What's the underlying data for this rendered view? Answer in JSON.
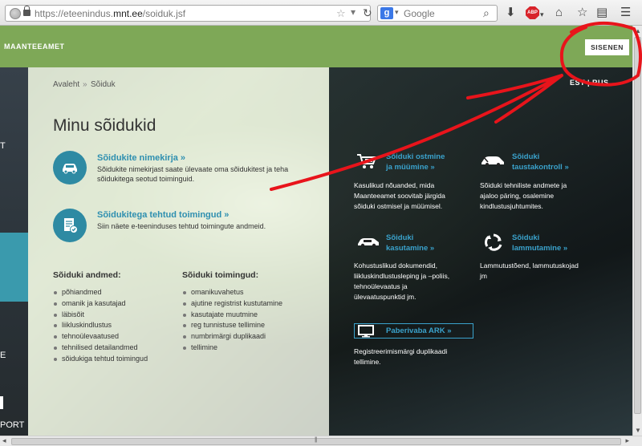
{
  "browser": {
    "url_prefix": "https://eteenindus.",
    "url_domain": "mnt.ee",
    "url_path": "/soiduk.jsf",
    "search_placeholder": "Google",
    "search_engine_glyph": "g",
    "abp_label": "ABP"
  },
  "header": {
    "logo": "MAANTEEAMET",
    "login_button": "SISENEN",
    "language": "EST | RUS",
    "brand_color": "#7ea857"
  },
  "left_nav": {
    "item_1": "T",
    "item_2": "E",
    "item_3": "PORT"
  },
  "breadcrumb": {
    "home": "Avaleht",
    "separator": "»",
    "current": "Sõiduk"
  },
  "page_title": "Minu sõidukid",
  "main_links": [
    {
      "icon": "car-icon",
      "title": "Sõidukite nimekirja »",
      "desc_line1": "Sõidukite nimekirjast saate ülevaate oma sõidukitest ja teha",
      "desc_line2": "sõidukitega seotud toiminguid."
    },
    {
      "icon": "document-check-icon",
      "title": "Sõidukitega tehtud toimingud »",
      "desc_line1": "Siin näete e-teeninduses tehtud toimingute andmeid."
    }
  ],
  "vehicle_data": {
    "title": "Sõiduki andmed:",
    "items": [
      "põhiandmed",
      "omanik ja kasutajad",
      "läbisõit",
      "liikluskindlustus",
      "tehnoülevaatused",
      "tehnilised detailandmed",
      "sõidukiga tehtud toimingud"
    ]
  },
  "vehicle_ops": {
    "title": "Sõiduki toimingud:",
    "items": [
      "omanikuvahetus",
      "ajutine registrist kustutamine",
      "kasutajate muutmine",
      "reg tunnistuse tellimine",
      "numbrimärgi duplikaadi",
      "tellimine"
    ]
  },
  "services": [
    {
      "icon": "shopping-cart-car-icon",
      "title_line1": "Sõiduki ostmine",
      "title_line2": "ja müümine »",
      "desc_lines": [
        "Kasulikud nõuanded, mida",
        "Maanteeamet soovitab järgida",
        "sõiduki ostmisel ja müümisel."
      ]
    },
    {
      "icon": "car-history-icon",
      "title_line1": "Sõiduki",
      "title_line2": "taustakontroll »",
      "desc_lines": [
        "Sõiduki tehniliste andmete ja",
        "ajaloo päring, osalemine",
        "kindlustusjuhtumites."
      ]
    },
    {
      "icon": "car-icon",
      "title_line1": "Sõiduki",
      "title_line2": "kasutamine »",
      "desc_lines": [
        "Kohustuslikud dokumendid,",
        "liikluskindlustusleping ja –poliis,",
        "tehnoülevaatus ja",
        "ülevaatuspunktid jm."
      ]
    },
    {
      "icon": "recycle-icon",
      "title_line1": "Sõiduki",
      "title_line2": "lammutamine »",
      "desc_lines": [
        "Lammutustõend, lammutuskojad",
        "jm"
      ]
    }
  ],
  "ark": {
    "icon": "monitor-icon",
    "title": "Paberivaba ARK »",
    "desc_line1": "Registreerimismärgi duplikaadi",
    "desc_line2": "tellimine."
  },
  "colors": {
    "link": "#2e8fb0",
    "dark_link": "#3aa2cc",
    "annotation": "#e8141b"
  }
}
